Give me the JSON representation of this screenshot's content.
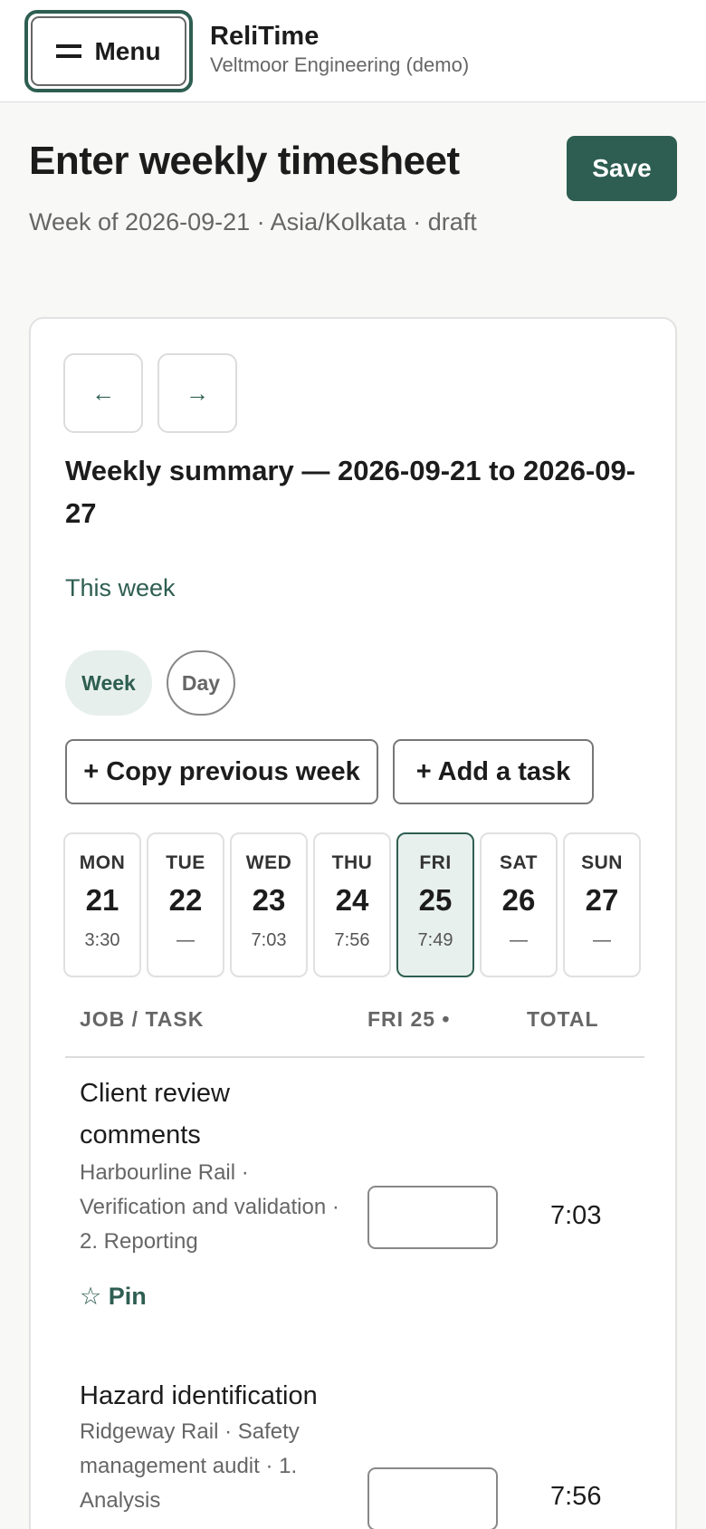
{
  "header": {
    "menu_label": "Menu",
    "app_name": "ReliTime",
    "org": "Veltmoor Engineering (demo)"
  },
  "page": {
    "title": "Enter weekly timesheet",
    "save_label": "Save",
    "subline": "Week of 2026-09-21 · Asia/Kolkata · draft"
  },
  "summary": {
    "prev_label": "←",
    "next_label": "→",
    "title": "Weekly summary — 2026-09-21 to 2026-09-27",
    "this_week": "This week",
    "views": [
      "Week",
      "Day"
    ],
    "copy_label": "+ Copy previous week",
    "add_label": "+ Add a task"
  },
  "days": [
    {
      "abbr": "MON",
      "num": "21",
      "hours": "3:30"
    },
    {
      "abbr": "TUE",
      "num": "22",
      "hours": "—"
    },
    {
      "abbr": "WED",
      "num": "23",
      "hours": "7:03"
    },
    {
      "abbr": "THU",
      "num": "24",
      "hours": "7:56"
    },
    {
      "abbr": "FRI",
      "num": "25",
      "hours": "7:49"
    },
    {
      "abbr": "SAT",
      "num": "26",
      "hours": "—"
    },
    {
      "abbr": "SUN",
      "num": "27",
      "hours": "—"
    }
  ],
  "table": {
    "col_job": "JOB / TASK",
    "col_day": "FRI 25 •",
    "col_total": "TOTAL",
    "rows": [
      {
        "name": "Client review comments",
        "meta": "Harbourline Rail · Verification and validation · 2. Reporting",
        "pin": "☆ Pin",
        "total": "7:03"
      },
      {
        "name": "Hazard identification",
        "meta": "Ridgeway Rail · Safety management audit · 1. Analysis",
        "total": "7:56"
      }
    ]
  },
  "colors": {
    "accent": "#2e5e51",
    "selected_bg": "#e8f0ed"
  }
}
